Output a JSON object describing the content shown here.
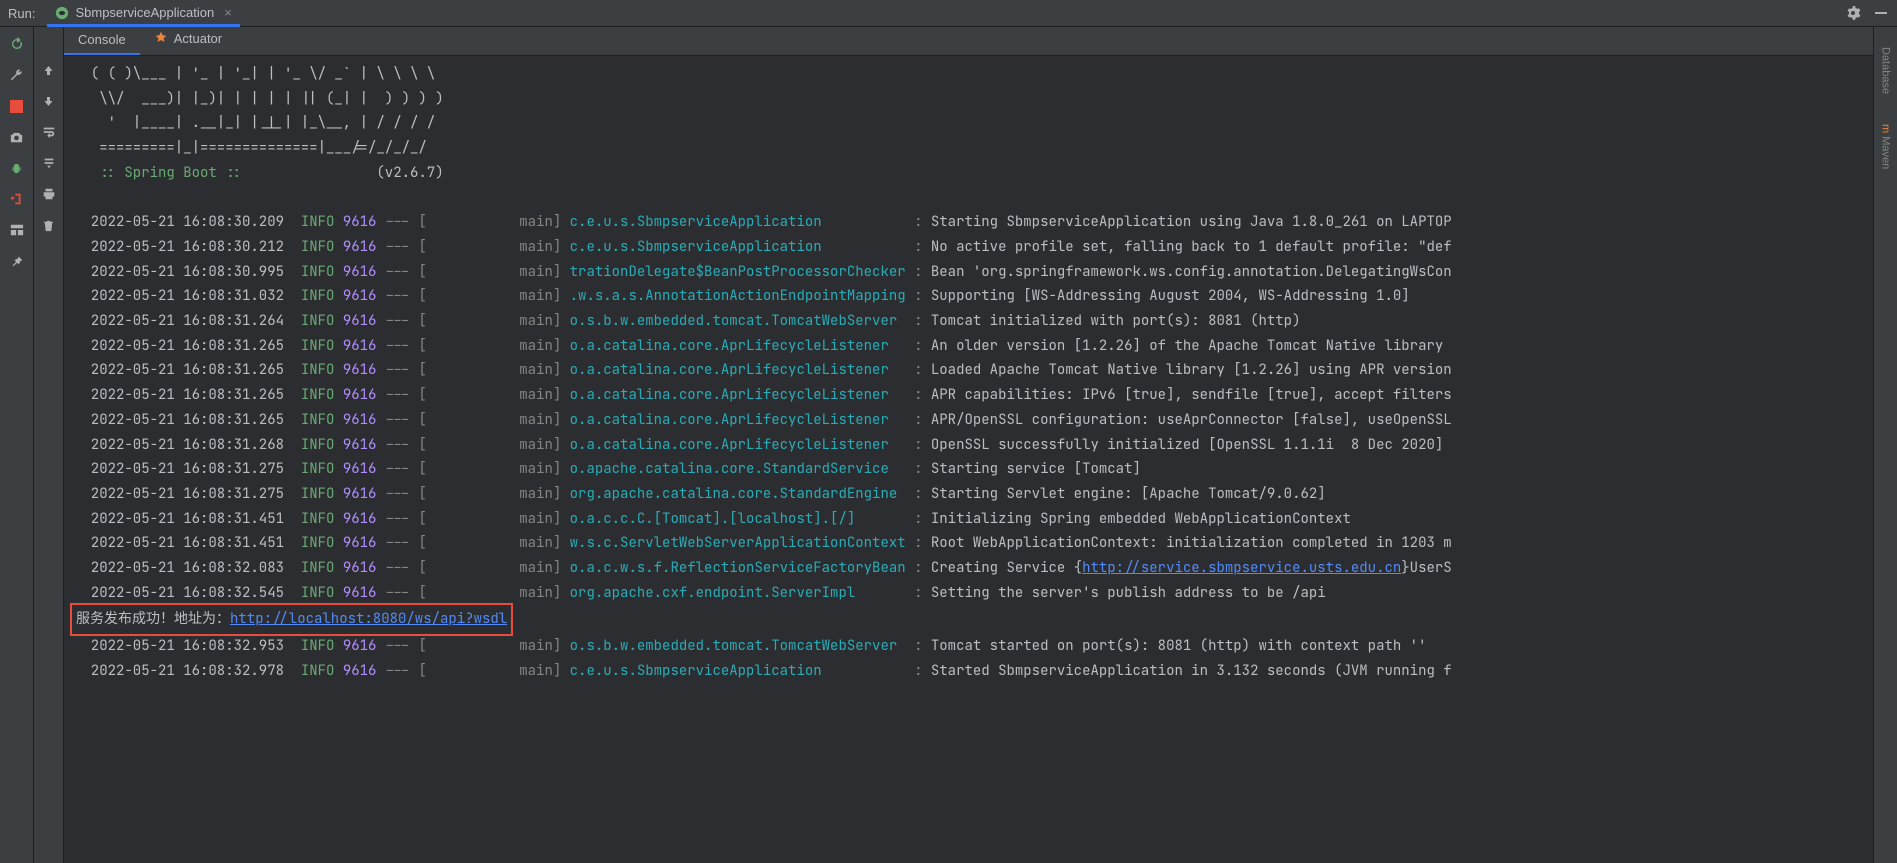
{
  "header": {
    "run_label": "Run:",
    "config_name": "SbmpserviceApplication",
    "close_x": "×"
  },
  "tabs": {
    "console": "Console",
    "actuator": "Actuator"
  },
  "right_rail": {
    "database": "Database",
    "maven": "Maven"
  },
  "ascii": {
    "l1": "  ( ( )\\___ | '_ | '_| | '_ \\/ _` | \\ \\ \\ \\",
    "l2": "   \\\\/  ___)| |_)| | | | | || (_| |  ) ) ) )",
    "l3": "    '  |____| .__|_| |_|_| |_\\__, | / / / /",
    "l4": "   =========|_|==============|___/=/_/_/_/",
    "l5_boot": "   :: Spring Boot ::",
    "l5_ver": "                (v2.6.7)"
  },
  "rows": [
    {
      "ts": "2022-05-21 16:08:30.209",
      "pid": "9616",
      "thr": "main",
      "log": "c.e.u.s.SbmpserviceApplication",
      "msg": "Starting SbmpserviceApplication using Java 1.8.0_261 on LAPTOP"
    },
    {
      "ts": "2022-05-21 16:08:30.212",
      "pid": "9616",
      "thr": "main",
      "log": "c.e.u.s.SbmpserviceApplication",
      "msg": "No active profile set, falling back to 1 default profile: \"def"
    },
    {
      "ts": "2022-05-21 16:08:30.995",
      "pid": "9616",
      "thr": "main",
      "log": "trationDelegate$BeanPostProcessorChecker",
      "msg_pre": "Bean 'org.springframework.ws.config.annotation.DelegatingWsCon",
      "msg": ""
    },
    {
      "ts": "2022-05-21 16:08:31.032",
      "pid": "9616",
      "thr": "main",
      "log": ".w.s.a.s.AnnotationActionEndpointMapping",
      "msg": "Supporting [WS-Addressing August 2004, WS-Addressing 1.0]"
    },
    {
      "ts": "2022-05-21 16:08:31.264",
      "pid": "9616",
      "thr": "main",
      "log": "o.s.b.w.embedded.tomcat.TomcatWebServer",
      "msg": "Tomcat initialized with port(s): 8081 (http)"
    },
    {
      "ts": "2022-05-21 16:08:31.265",
      "pid": "9616",
      "thr": "main",
      "log": "o.a.catalina.core.AprLifecycleListener",
      "msg": "An older version [1.2.26] of the Apache Tomcat Native library"
    },
    {
      "ts": "2022-05-21 16:08:31.265",
      "pid": "9616",
      "thr": "main",
      "log": "o.a.catalina.core.AprLifecycleListener",
      "msg": "Loaded Apache Tomcat Native library [1.2.26] using APR version"
    },
    {
      "ts": "2022-05-21 16:08:31.265",
      "pid": "9616",
      "thr": "main",
      "log": "o.a.catalina.core.AprLifecycleListener",
      "msg": "APR capabilities: IPv6 [true], sendfile [true], accept filters"
    },
    {
      "ts": "2022-05-21 16:08:31.265",
      "pid": "9616",
      "thr": "main",
      "log": "o.a.catalina.core.AprLifecycleListener",
      "msg": "APR/OpenSSL configuration: useAprConnector [false], useOpenSSL"
    },
    {
      "ts": "2022-05-21 16:08:31.268",
      "pid": "9616",
      "thr": "main",
      "log": "o.a.catalina.core.AprLifecycleListener",
      "msg": "OpenSSL successfully initialized [OpenSSL 1.1.1i  8 Dec 2020]"
    },
    {
      "ts": "2022-05-21 16:08:31.275",
      "pid": "9616",
      "thr": "main",
      "log": "o.apache.catalina.core.StandardService",
      "msg": "Starting service [Tomcat]"
    },
    {
      "ts": "2022-05-21 16:08:31.275",
      "pid": "9616",
      "thr": "main",
      "log": "org.apache.catalina.core.StandardEngine",
      "msg": "Starting Servlet engine: [Apache Tomcat/9.0.62]"
    },
    {
      "ts": "2022-05-21 16:08:31.451",
      "pid": "9616",
      "thr": "main",
      "log": "o.a.c.c.C.[Tomcat].[localhost].[/]",
      "msg": "Initializing Spring embedded WebApplicationContext"
    },
    {
      "ts": "2022-05-21 16:08:31.451",
      "pid": "9616",
      "thr": "main",
      "log": "w.s.c.ServletWebServerApplicationContext",
      "msg": "Root WebApplicationContext: initialization completed in 1203 m"
    },
    {
      "ts": "2022-05-21 16:08:32.083",
      "pid": "9616",
      "thr": "main",
      "log": "o.a.c.w.s.f.ReflectionServiceFactoryBean",
      "msg_pre": "Creating Service {",
      "link": "http://service.sbmpservice.usts.edu.cn",
      "msg_post": "}UserS"
    },
    {
      "ts": "2022-05-21 16:08:32.545",
      "pid": "9616",
      "thr": "main",
      "log": "org.apache.cxf.endpoint.ServerImpl",
      "msg": "Setting the server's publish address to be /api"
    }
  ],
  "highlight": {
    "text_pre": "服务发布成功！地址为：",
    "link": "http://localhost:8080/ws/api?wsdl"
  },
  "rows_after": [
    {
      "ts": "2022-05-21 16:08:32.953",
      "pid": "9616",
      "thr": "main",
      "log": "o.s.b.w.embedded.tomcat.TomcatWebServer",
      "msg": "Tomcat started on port(s): 8081 (http) with context path ''"
    },
    {
      "ts": "2022-05-21 16:08:32.978",
      "pid": "9616",
      "thr": "main",
      "log": "c.e.u.s.SbmpserviceApplication",
      "msg": "Started SbmpserviceApplication in 3.132 seconds (JVM running f"
    }
  ],
  "level": "INFO"
}
